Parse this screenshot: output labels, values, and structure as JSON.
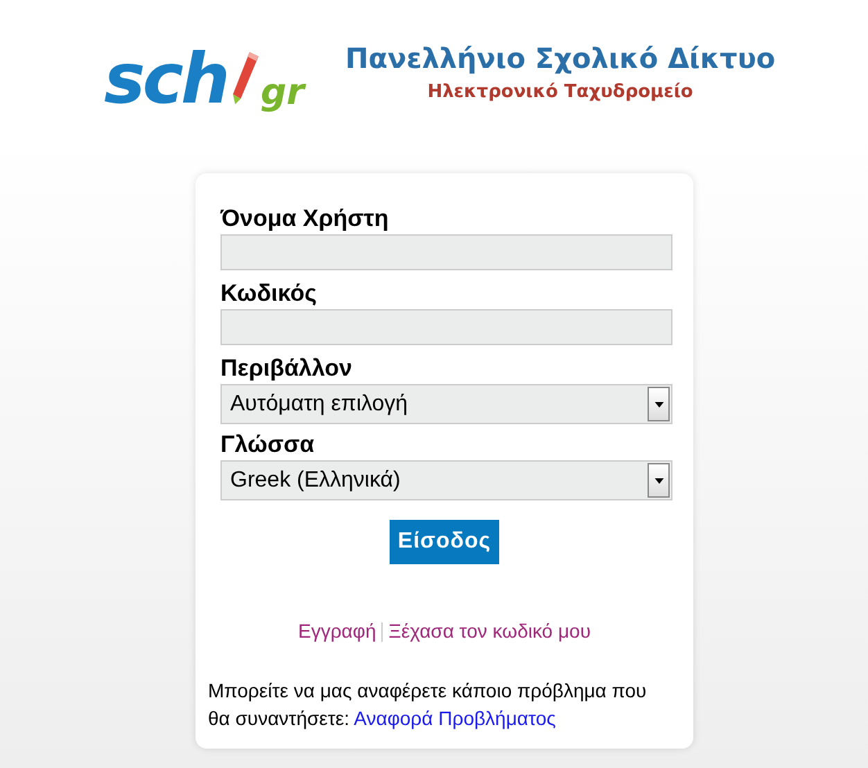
{
  "logo": {
    "main": "sch",
    "suffix": "gr"
  },
  "header": {
    "title": "Πανελλήνιο Σχολικό Δίκτυο",
    "subtitle": "Ηλεκτρονικό Ταχυδρομείο"
  },
  "form": {
    "fields": [
      {
        "kind": "text",
        "label": "Όνομα Χρήστη"
      },
      {
        "kind": "password",
        "label": "Κωδικός"
      },
      {
        "kind": "select",
        "label": "Περιβάλλον",
        "value": "Αυτόματη επιλογή"
      },
      {
        "kind": "select",
        "label": "Γλώσσα",
        "value": "Greek (Ελληνικά)"
      }
    ],
    "submit": "Είσοδος"
  },
  "links": [
    "Εγγραφή",
    "Ξέχασα τον κωδικό μου"
  ],
  "report": {
    "text": "Μπορείτε να μας αναφέρετε κάποιο πρόβλημα που θα συναντήσετε:",
    "link": "Αναφορά Προβλήματος"
  }
}
